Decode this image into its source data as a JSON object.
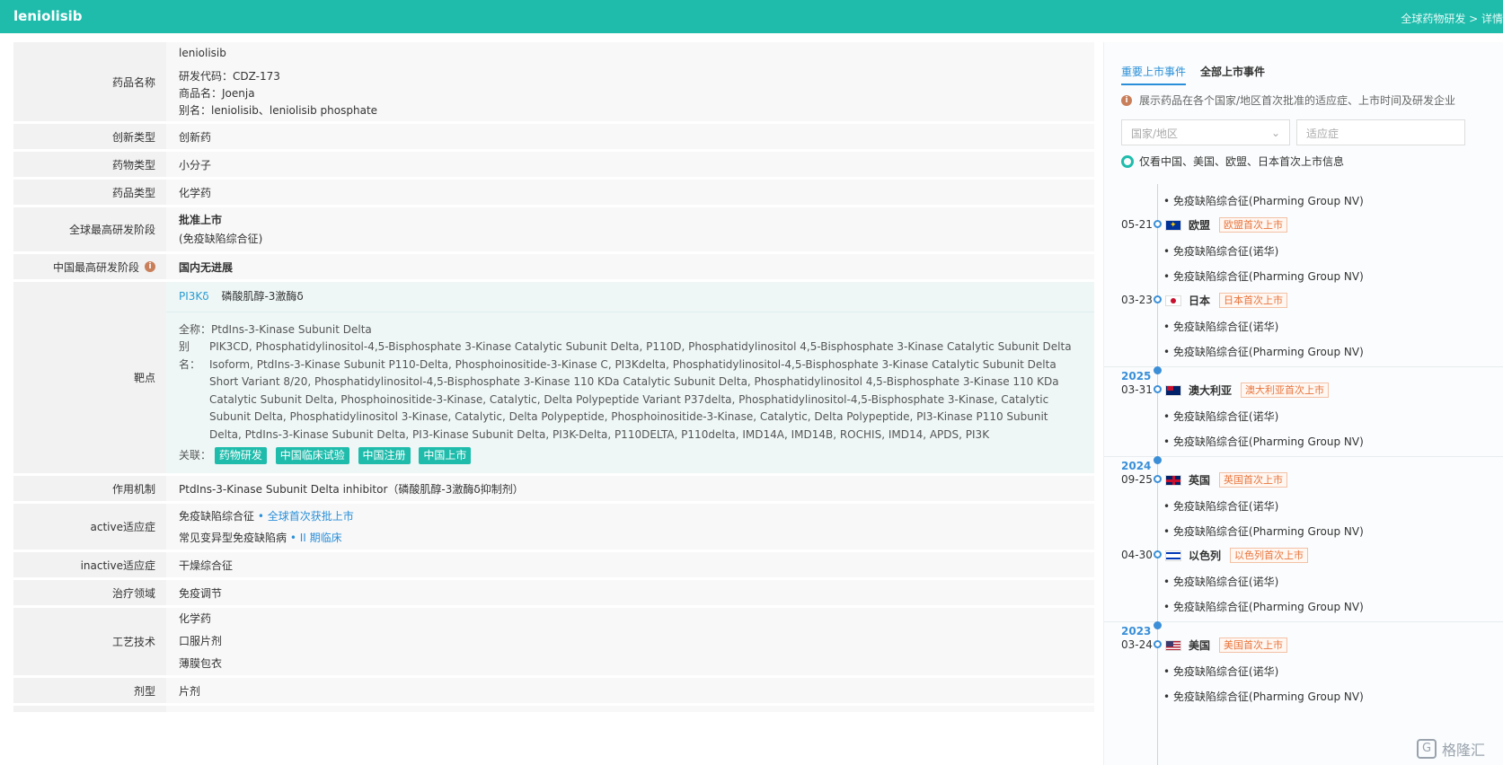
{
  "header": {
    "title": "leniolisib",
    "breadcrumb": "全球药物研发 > 详情"
  },
  "fields": {
    "name_label": "药品名称",
    "name_main": "leniolisib",
    "code": "研发代码：CDZ-173",
    "trade": "商品名：Joenja",
    "alias": "别名：leniolisib、leniolisib phosphate",
    "innov_label": "创新类型",
    "innov_val": "创新药",
    "drugtype_label": "药物类型",
    "drugtype_val": "小分子",
    "category_label": "药品类型",
    "category_val": "化学药",
    "phase_label": "全球最高研发阶段",
    "phase_val": "批准上市",
    "phase_sub": "(免疫缺陷综合征)",
    "cn_phase_label": "中国最高研发阶段",
    "cn_phase_val": "国内无进展",
    "target_label": "靶点",
    "target_link": "PI3Kδ",
    "target_cn": "磷酸肌醇-3激酶δ",
    "fullname": "全称：PtdIns-3-Kinase Subunit Delta",
    "alias_key": "别名：",
    "alias_val": "PIK3CD, Phosphatidylinositol-4,5-Bisphosphate 3-Kinase Catalytic Subunit Delta, P110D, Phosphatidylinositol 4,5-Bisphosphate 3-Kinase Catalytic Subunit Delta Isoform, PtdIns-3-Kinase Subunit P110-Delta, Phosphoinositide-3-Kinase C, PI3Kdelta, Phosphatidylinositol-4,5-Bisphosphate 3-Kinase Catalytic Subunit Delta Short Variant 8/20, Phosphatidylinositol-4,5-Bisphosphate 3-Kinase 110 KDa Catalytic Subunit Delta, Phosphatidylinositol 4,5-Bisphosphate 3-Kinase 110 KDa Catalytic Subunit Delta, Phosphoinositide-3-Kinase, Catalytic, Delta Polypeptide Variant P37delta, Phosphatidylinositol-4,5-Bisphosphate 3-Kinase, Catalytic Subunit Delta, Phosphatidylinositol 3-Kinase, Catalytic, Delta Polypeptide, Phosphoinositide-3-Kinase, Catalytic, Delta Polypeptide, PI3-Kinase P110 Subunit Delta, PtdIns-3-Kinase Subunit Delta, PI3-Kinase Subunit Delta, PI3K-Delta, P110DELTA, P110delta, IMD14A, IMD14B, ROCHIS, IMD14, APDS, PI3K",
    "related_key": "关联：",
    "tags": [
      "药物研发",
      "中国临床试验",
      "中国注册",
      "中国上市"
    ],
    "mech_label": "作用机制",
    "mech_val": "PtdIns-3-Kinase Subunit Delta inhibitor（磷酸肌醇-3激酶δ抑制剂）",
    "active_label": "active适应症",
    "active1": "免疫缺陷综合征",
    "active1_link": "• 全球首次获批上市",
    "active2": "常见变异型免疫缺陷病",
    "active2_link": "• II 期临床",
    "inactive_label": "inactive适应症",
    "inactive_val": "干燥综合征",
    "area_label": "治疗领域",
    "area_val": "免疫调节",
    "tech_label": "工艺技术",
    "tech1": "化学药",
    "tech2": "口服片剂",
    "tech3": "薄膜包衣",
    "form_label": "剂型",
    "form_val": "片剂"
  },
  "panel": {
    "tab_active": "重要上市事件",
    "tab_other": "全部上市事件",
    "note": "展示药品在各个国家/地区首次批准的适应症、上市时间及研发企业",
    "country_placeholder": "国家/地区",
    "indication_placeholder": "适应症",
    "radio_label": "仅看中国、美国、欧盟、日本首次上市信息"
  },
  "timeline": {
    "b_pharming": "• 免疫缺陷综合征(Pharming Group NV)",
    "b_novartis": "• 免疫缺陷综合征(诺华)",
    "eu_date": "05-21",
    "eu_name": "欧盟",
    "eu_badge": "欧盟首次上市",
    "jp_date": "03-23",
    "jp_name": "日本",
    "jp_badge": "日本首次上市",
    "y2025": "2025",
    "au_date": "03-31",
    "au_name": "澳大利亚",
    "au_badge": "澳大利亚首次上市",
    "y2024": "2024",
    "uk_date": "09-25",
    "uk_name": "英国",
    "uk_badge": "英国首次上市",
    "il_date": "04-30",
    "il_name": "以色列",
    "il_badge": "以色列首次上市",
    "y2023": "2023",
    "us_date": "03-24",
    "us_name": "美国",
    "us_badge": "美国首次上市"
  },
  "watermark": "格隆汇",
  "colors": {
    "brand": "#1fbcac",
    "link": "#2a8fd8",
    "badge": "#e8743b"
  }
}
